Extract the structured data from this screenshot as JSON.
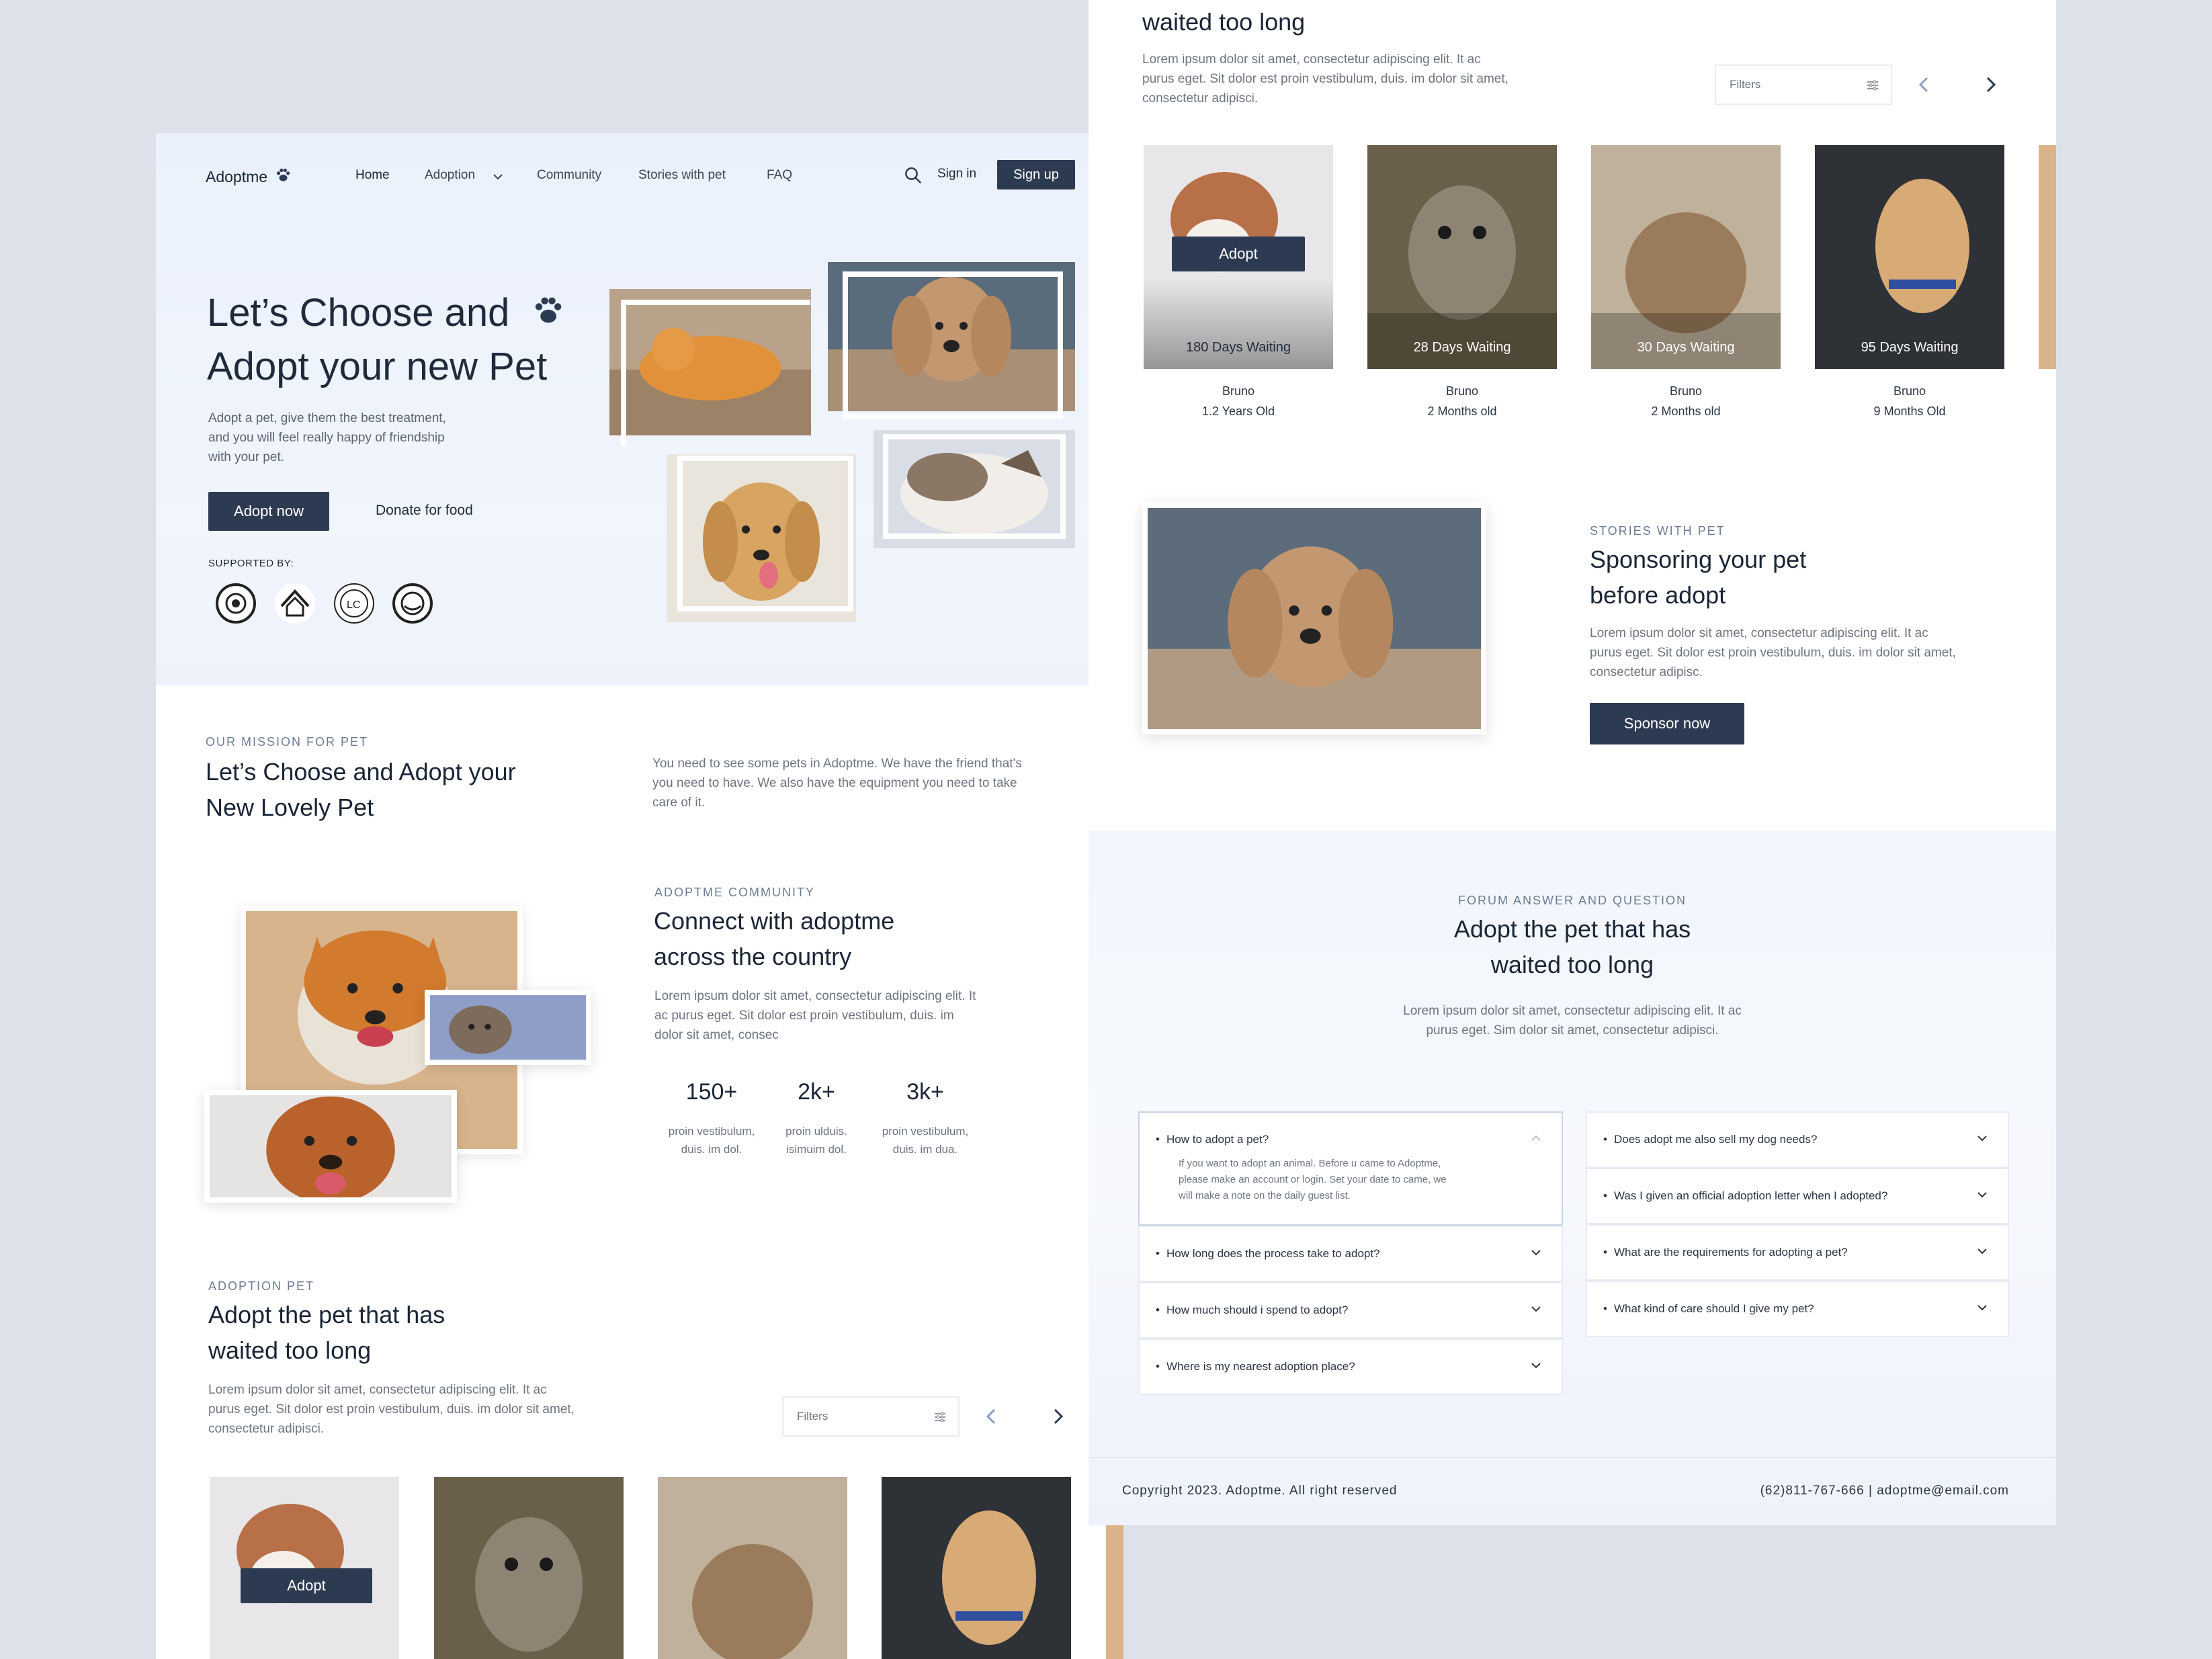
{
  "brand": {
    "name": "Adoptme",
    "paw_icon": "paw-icon"
  },
  "nav": {
    "home": "Home",
    "adoption": "Adoption",
    "community": "Community",
    "stories": "Stories with pet",
    "faq": "FAQ",
    "sign_in": "Sign in",
    "sign_up": "Sign up"
  },
  "hero": {
    "title_line1": "Let’s Choose and",
    "title_line2": "Adopt your new Pet",
    "text_line1": "Adopt a pet, give them the best treatment,",
    "text_line2": "and you will feel really happy of friendship",
    "text_line3": "with your pet.",
    "adopt_button": "Adopt now",
    "donate_link": "Donate for food",
    "supported_by": "SUPPORTED BY:"
  },
  "mission": {
    "eyebrow": "OUR MISSION FOR PET",
    "title_line1": "Let’s Choose and Adopt your",
    "title_line2": "New Lovely Pet",
    "text_line1": "You need to see some pets in Adoptme. We have the friend that's",
    "text_line2": "you need to have. We also have the equipment you need to take",
    "text_line3": "care of it."
  },
  "community": {
    "eyebrow": "ADOPTME COMMUNITY",
    "title_line1": "Connect with adoptme",
    "title_line2": "across the country",
    "text_line1": "Lorem ipsum dolor sit amet, consectetur adipiscing elit. It",
    "text_line2": "ac purus eget. Sit dolor est proin vestibulum, duis. im",
    "text_line3": "dolor sit amet, consec",
    "stats": [
      {
        "value": "150+",
        "line1": "proin vestibulum,",
        "line2": "duis. im dol."
      },
      {
        "value": "2k+",
        "line1": "proin ulduis.",
        "line2": "isimuim dol."
      },
      {
        "value": "3k+",
        "line1": "proin vestibulum,",
        "line2": "duis. im dua."
      }
    ]
  },
  "adoption": {
    "eyebrow": "ADOPTION PET",
    "title_line1": "Adopt the pet that has",
    "title_line2": "waited too long",
    "text_line1": "Lorem ipsum dolor sit amet, consectetur adipiscing elit. It ac",
    "text_line2": "purus eget. Sit dolor est proin vestibulum, duis. im dolor sit amet,",
    "text_line3": "consectetur adipisci.",
    "filters_placeholder": "Filters",
    "adopt_button": "Adopt",
    "pets": [
      {
        "waiting": "180 Days Waiting",
        "name": "Bruno",
        "age": "1.2 Years Old"
      },
      {
        "waiting": "28 Days Waiting",
        "name": "Bruno",
        "age": "2 Months old"
      },
      {
        "waiting": "30 Days Waiting",
        "name": "Bruno",
        "age": "2 Months old"
      },
      {
        "waiting": "95 Days Waiting",
        "name": "Bruno",
        "age": "9 Months Old"
      }
    ]
  },
  "stories": {
    "eyebrow": "STORIES WITH PET",
    "title_line1": "Sponsoring your pet",
    "title_line2": "before adopt",
    "text_line1": "Lorem ipsum dolor sit amet, consectetur adipiscing elit. It ac",
    "text_line2": "purus eget. Sit dolor est proin vestibulum, duis. im dolor sit amet,",
    "text_line3": "consectetur adipisc.",
    "button": "Sponsor now"
  },
  "forum": {
    "eyebrow": "FORUM ANSWER AND QUESTION",
    "title_line1": "Adopt the pet that has",
    "title_line2": "waited too long",
    "text_line1": "Lorem ipsum dolor sit amet, consectetur adipiscing elit. It ac",
    "text_line2": "purus eget. Sim dolor sit amet, consectetur adipisci.",
    "open_question": "How to adopt a pet?",
    "open_answer_line1": "If you want to adopt an animal. Before u came to Adoptme,",
    "open_answer_line2": "please make an account or login. Set your date to came, we",
    "open_answer_line3": "will make a note on the daily guest list.",
    "left_questions": [
      "How long does the process take to adopt?",
      "How much should i spend to adopt?",
      "Where is my nearest adoption place?"
    ],
    "right_questions": [
      "Does adopt me also sell my dog needs?",
      "Was I given an official adoption letter when I adopted?",
      "What are the requirements for adopting a pet?",
      "What kind of care should I give my pet?"
    ]
  },
  "footer": {
    "copyright": "Copyright 2023. Adoptme. All right reserved",
    "contact": "(62)811-767-666 | adoptme@email.com"
  },
  "colors": {
    "primary": "#2d3b52",
    "background": "#dde2ea",
    "hero_bg": "#eef3fb"
  }
}
